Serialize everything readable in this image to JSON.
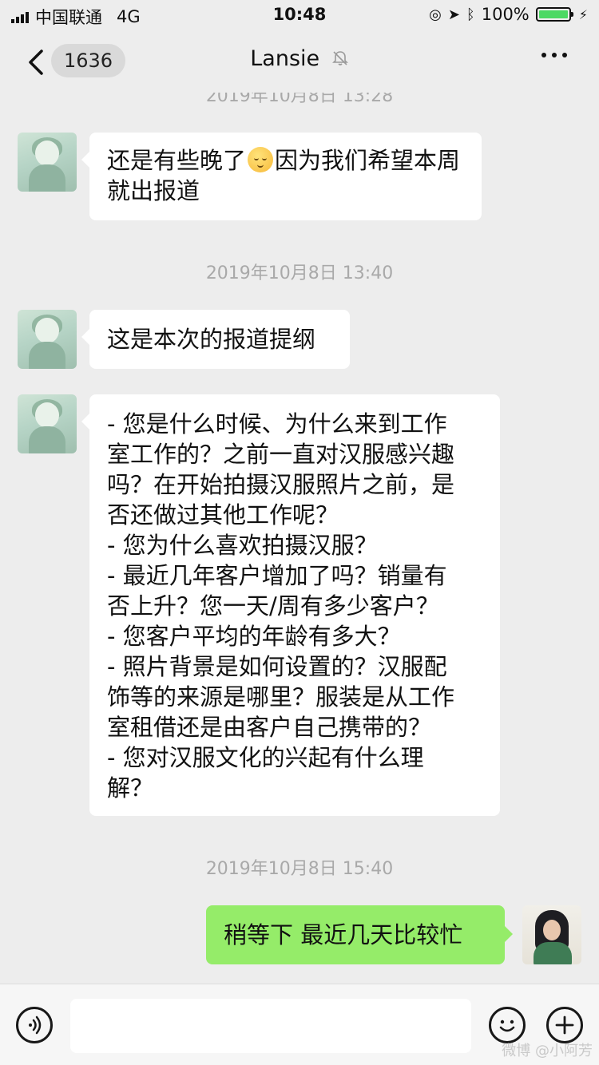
{
  "status_bar": {
    "carrier": "中国联通",
    "network": "4G",
    "time": "10:48",
    "battery": "100%"
  },
  "nav": {
    "unread_count": "1636",
    "title": "Lansie"
  },
  "messages": [
    {
      "timestamp": "2019年10月8日 13:28"
    },
    {
      "sender": "other",
      "text_before_emoji": "还是有些晚了",
      "emoji": "smiling-face-emoji",
      "text_after_emoji": "因为我们希望本周就出报道"
    },
    {
      "timestamp": "2019年10月8日 13:40"
    },
    {
      "sender": "other",
      "text": "这是本次的报道提纲"
    },
    {
      "sender": "other",
      "lines": [
        "- 您是什么时候、为什么来到工作",
        "室工作的？之前一直对汉服感兴趣",
        "吗？在开始拍摄汉服照片之前，是",
        "否还做过其他工作呢？",
        "- 您为什么喜欢拍摄汉服？",
        "- 最近几年客户增加了吗？销量有",
        "否上升？您一天/周有多少客户？",
        "- 您客户平均的年龄有多大？",
        "- 照片背景是如何设置的？汉服配",
        "饰等的来源是哪里？服装是从工作",
        "室租借还是由客户自己携带的？",
        "- 您对汉服文化的兴起有什么理",
        "解？"
      ]
    },
    {
      "timestamp": "2019年10月8日 15:40"
    },
    {
      "sender": "me",
      "text": "稍等下 最近几天比较忙"
    }
  ],
  "input_bar": {
    "placeholder": ""
  },
  "watermark": "微博 @小阿芳",
  "icons": [
    "back-chevron-icon",
    "mute-bell-icon",
    "more-dots-icon",
    "voice-icon",
    "emoji-icon",
    "plus-icon",
    "signal-icon",
    "wifi-arrow-icon",
    "bluetooth-icon",
    "battery-icon"
  ]
}
